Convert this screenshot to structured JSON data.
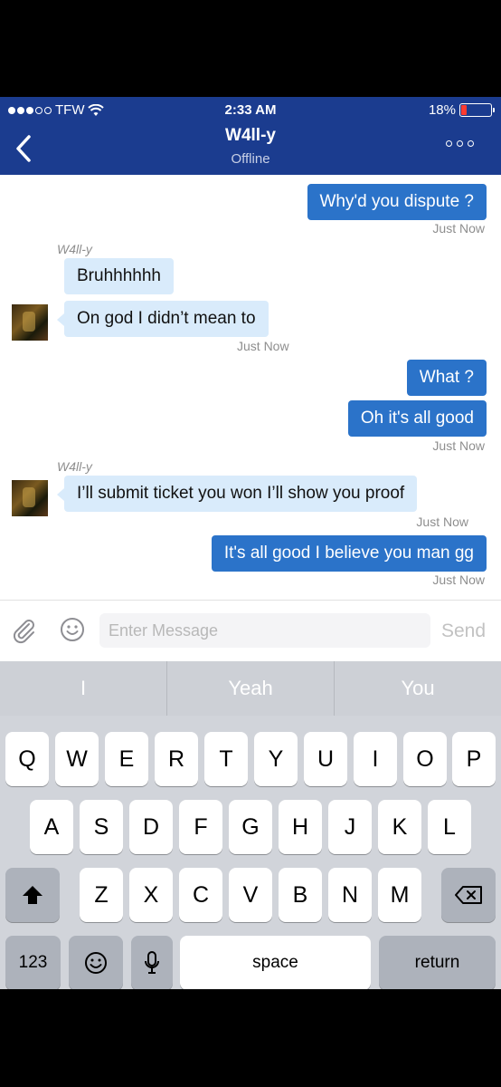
{
  "status_bar": {
    "carrier": "TFW",
    "time": "2:33 AM",
    "battery": "18%",
    "battery_level": 0.18
  },
  "header": {
    "contact_name": "W4ll-y",
    "presence": "Offline"
  },
  "messages": [
    {
      "direction": "out",
      "text": "Why'd you dispute ?",
      "timestamp": "Just Now"
    },
    {
      "direction": "in",
      "sender": "W4ll-y",
      "text": "Bruhhhhhh"
    },
    {
      "direction": "in",
      "text": "On god I didn’t mean to",
      "timestamp": "Just Now"
    },
    {
      "direction": "out",
      "text": "What ?"
    },
    {
      "direction": "out",
      "text": "Oh it's all good",
      "timestamp": "Just Now"
    },
    {
      "direction": "in",
      "sender": "W4ll-y",
      "text": "I’ll submit ticket you won I’ll show you proof",
      "timestamp": "Just Now"
    },
    {
      "direction": "out",
      "text": "It's all good I believe you man gg",
      "timestamp": "Just Now"
    }
  ],
  "composer": {
    "placeholder": "Enter Message",
    "send_label": "Send"
  },
  "keyboard": {
    "predictions": [
      "I",
      "Yeah",
      "You"
    ],
    "row1": [
      "Q",
      "W",
      "E",
      "R",
      "T",
      "Y",
      "U",
      "I",
      "O",
      "P"
    ],
    "row2": [
      "A",
      "S",
      "D",
      "F",
      "G",
      "H",
      "J",
      "K",
      "L"
    ],
    "row3": [
      "Z",
      "X",
      "C",
      "V",
      "B",
      "N",
      "M"
    ],
    "numbers_label": "123",
    "space_label": "space",
    "return_label": "return"
  }
}
